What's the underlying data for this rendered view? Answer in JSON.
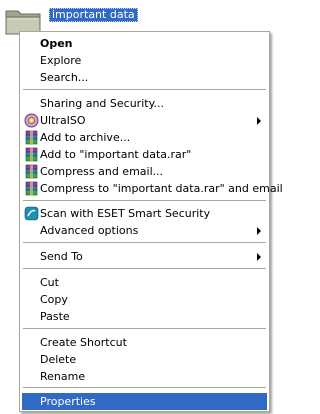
{
  "desktop": {
    "folder_name": "important data"
  },
  "menu": {
    "open": "Open",
    "explore": "Explore",
    "search": "Search...",
    "sharing": "Sharing and Security...",
    "ultraiso": "UltraISO",
    "add_archive": "Add to archive...",
    "add_rar": "Add to \"important data.rar\"",
    "compress_email": "Compress and email...",
    "compress_rar_email": "Compress to \"important data.rar\" and email",
    "eset": "Scan with ESET Smart Security",
    "advanced": "Advanced options",
    "send_to": "Send To",
    "cut": "Cut",
    "copy": "Copy",
    "paste": "Paste",
    "create_shortcut": "Create Shortcut",
    "delete": "Delete",
    "rename": "Rename",
    "properties": "Properties"
  },
  "icons": {
    "folder": "folder-icon",
    "ultraiso": "ultraiso-icon",
    "winrar": "winrar-icon",
    "eset": "eset-icon",
    "submenu": "submenu-arrow-icon"
  },
  "colors": {
    "highlight": "#316ac5",
    "menu_border": "#aca899",
    "folder": "#b9bba6"
  }
}
